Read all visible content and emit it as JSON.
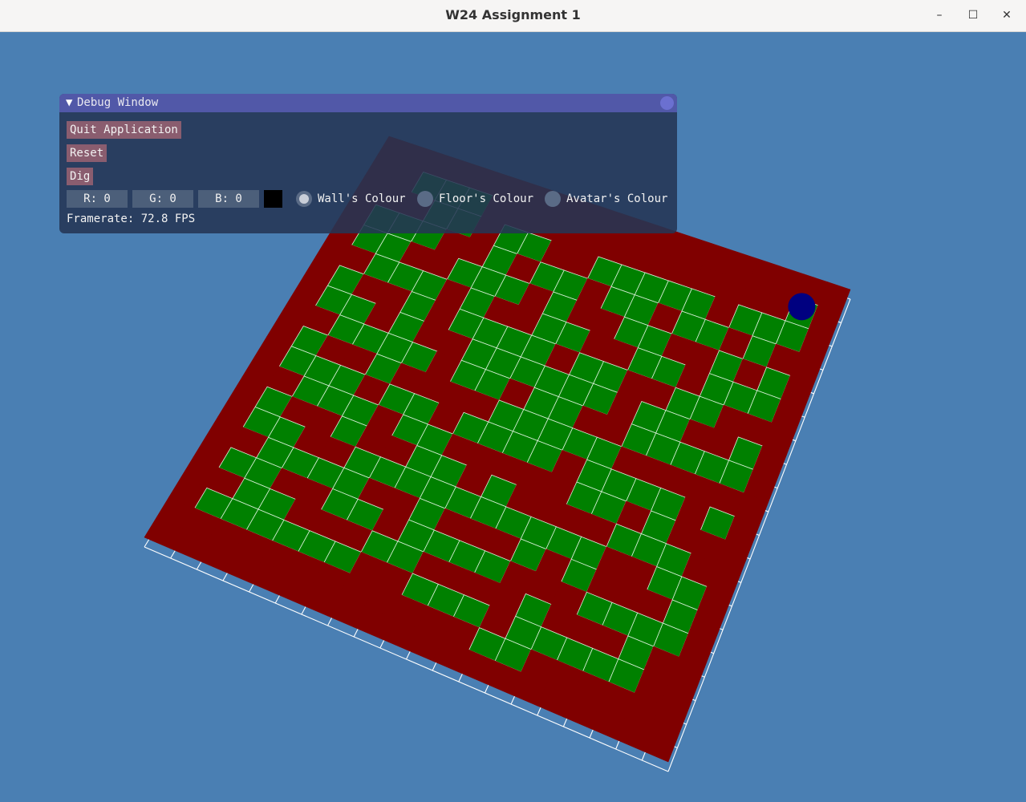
{
  "window": {
    "title": "W24 Assignment 1",
    "minimize_glyph": "–",
    "maximize_glyph": "☐",
    "close_glyph": "✕"
  },
  "colors": {
    "background": "#4a7fb3",
    "wall": "#800000",
    "floor": "#008000",
    "avatar": "#000080",
    "grid": "#ffffff"
  },
  "debug_window": {
    "title": "Debug Window",
    "collapse_glyph": "▼",
    "buttons": {
      "quit": "Quit Application",
      "reset": "Reset",
      "dig": "Dig"
    },
    "color_inputs": {
      "r": "R:  0",
      "g": "G:  0",
      "b": "B:  0"
    },
    "swatch_color": "#000000",
    "radios": [
      {
        "label": "Wall's Colour",
        "selected": true
      },
      {
        "label": "Floor's Colour",
        "selected": false
      },
      {
        "label": "Avatar's Colour",
        "selected": false
      }
    ],
    "framerate": "Framerate: 72.8 FPS"
  },
  "maze": {
    "size": 20,
    "rows": [
      "WWWWWWWWWWWWWWWWWWWW",
      "WWFFFWWWWWWWWWWWWWAW",
      "WWWFFWFFWWFFFFFWFFFW",
      "WFFFWWFWFFWFFWFFWFWW",
      "WFFWWFFFWFWWFFWWFWFW",
      "WWFFFWFWWFFWWFFWFFFW",
      "WFWWFWFFFFWFFWWFFWWW",
      "WFFWFWWFFFFFFWFFWWFW",
      "WWFFFFWFFWFFWWFFFFFW",
      "WFWWFWWWWFFFFFWWWWWW",
      "WFFFWFFWFFFFWFFFFWFW",
      "WWFFFWFFWWWWWFFWFWWW",
      "WFWWFWWFFWFWWWWFFFWW",
      "WFFWWFFFFFFFFFFWWFFW",
      "WWFFFFWWFWWWFWFWWWFW",
      "WFFWWFFWFFFFWWWFFFFW",
      "WWFFWWWFFWWWWFWWWFWW",
      "WFFFFFFWWFFFWFFFFFWW",
      "WWWWWWWWWWWWFFWWWWWW",
      "WWWWWWWWWWWWWWWWWWWW"
    ]
  }
}
